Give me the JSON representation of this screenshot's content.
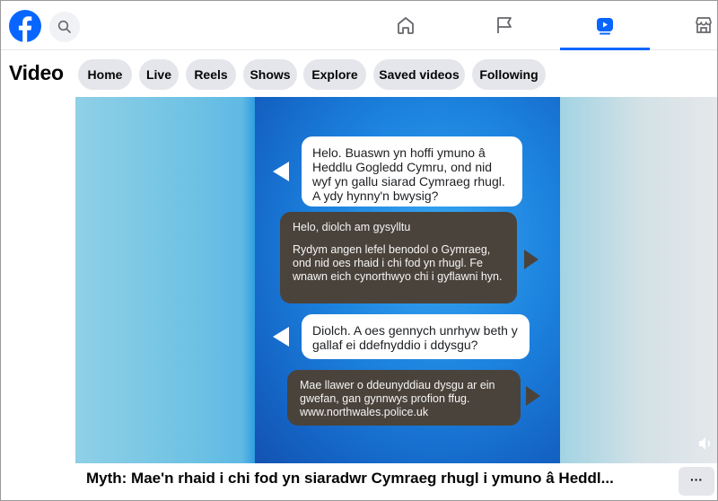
{
  "page": {
    "heading": "Video"
  },
  "nav": {
    "tabs": [
      {
        "icon": "home-icon"
      },
      {
        "icon": "flag-icon"
      },
      {
        "icon": "video-icon",
        "active": true
      },
      {
        "icon": "marketplace-icon"
      }
    ]
  },
  "filters": [
    "Home",
    "Live",
    "Reels",
    "Shows",
    "Explore",
    "Saved videos",
    "Following"
  ],
  "video": {
    "messages": [
      {
        "text": "Helo. Buaswn yn hoffi ymuno â Heddlu Gogledd Cymru, ond nid wyf yn gallu siarad Cymraeg rhugl. A ydy hynny'n bwysig?"
      },
      {
        "greeting": "Helo, diolch am gysylltu",
        "text": "Rydym angen lefel benodol o Gymraeg, ond nid oes rhaid i chi fod yn rhugl. Fe wnawn eich cynorthwyo chi i gyflawni hyn."
      },
      {
        "text": "Diolch. A oes gennych unrhyw beth y gallaf ei ddefnyddio i ddysgu?"
      },
      {
        "text": "Mae llawer o ddeunyddiau dysgu ar ein gwefan, gan gynnwys profion ffug. www.northwales.police.uk"
      }
    ],
    "caption": "Myth: Mae'n rhaid i chi fod yn siaradwr Cymraeg rhugl i ymuno â Heddl...",
    "more_label": "···"
  },
  "colors": {
    "brand": "#0866ff",
    "pill_bg": "#e4e6eb",
    "dark_bubble": "#4a433b"
  }
}
